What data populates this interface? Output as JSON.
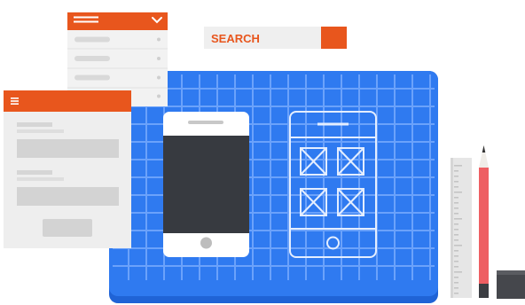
{
  "search": {
    "label": "SEARCH"
  },
  "colors": {
    "accent_orange": "#e8561d",
    "blueprint_blue": "#2f7af0",
    "blueprint_edge": "#1f63d6",
    "device_dark": "#373a40",
    "panel_gray": "#eeeeee",
    "ruler_gray": "#e6e6e6",
    "pencil_red": "#ee5e62",
    "block_dark": "#45474c"
  },
  "icons": {
    "dropdown_header": "hamburger-icon",
    "dropdown_toggle": "chevron-down-icon",
    "form_header": "hamburger-icon",
    "wireframe_images": "image-placeholder-icon"
  },
  "dropdown": {
    "item_count": 4
  },
  "form": {
    "field_count": 2
  }
}
